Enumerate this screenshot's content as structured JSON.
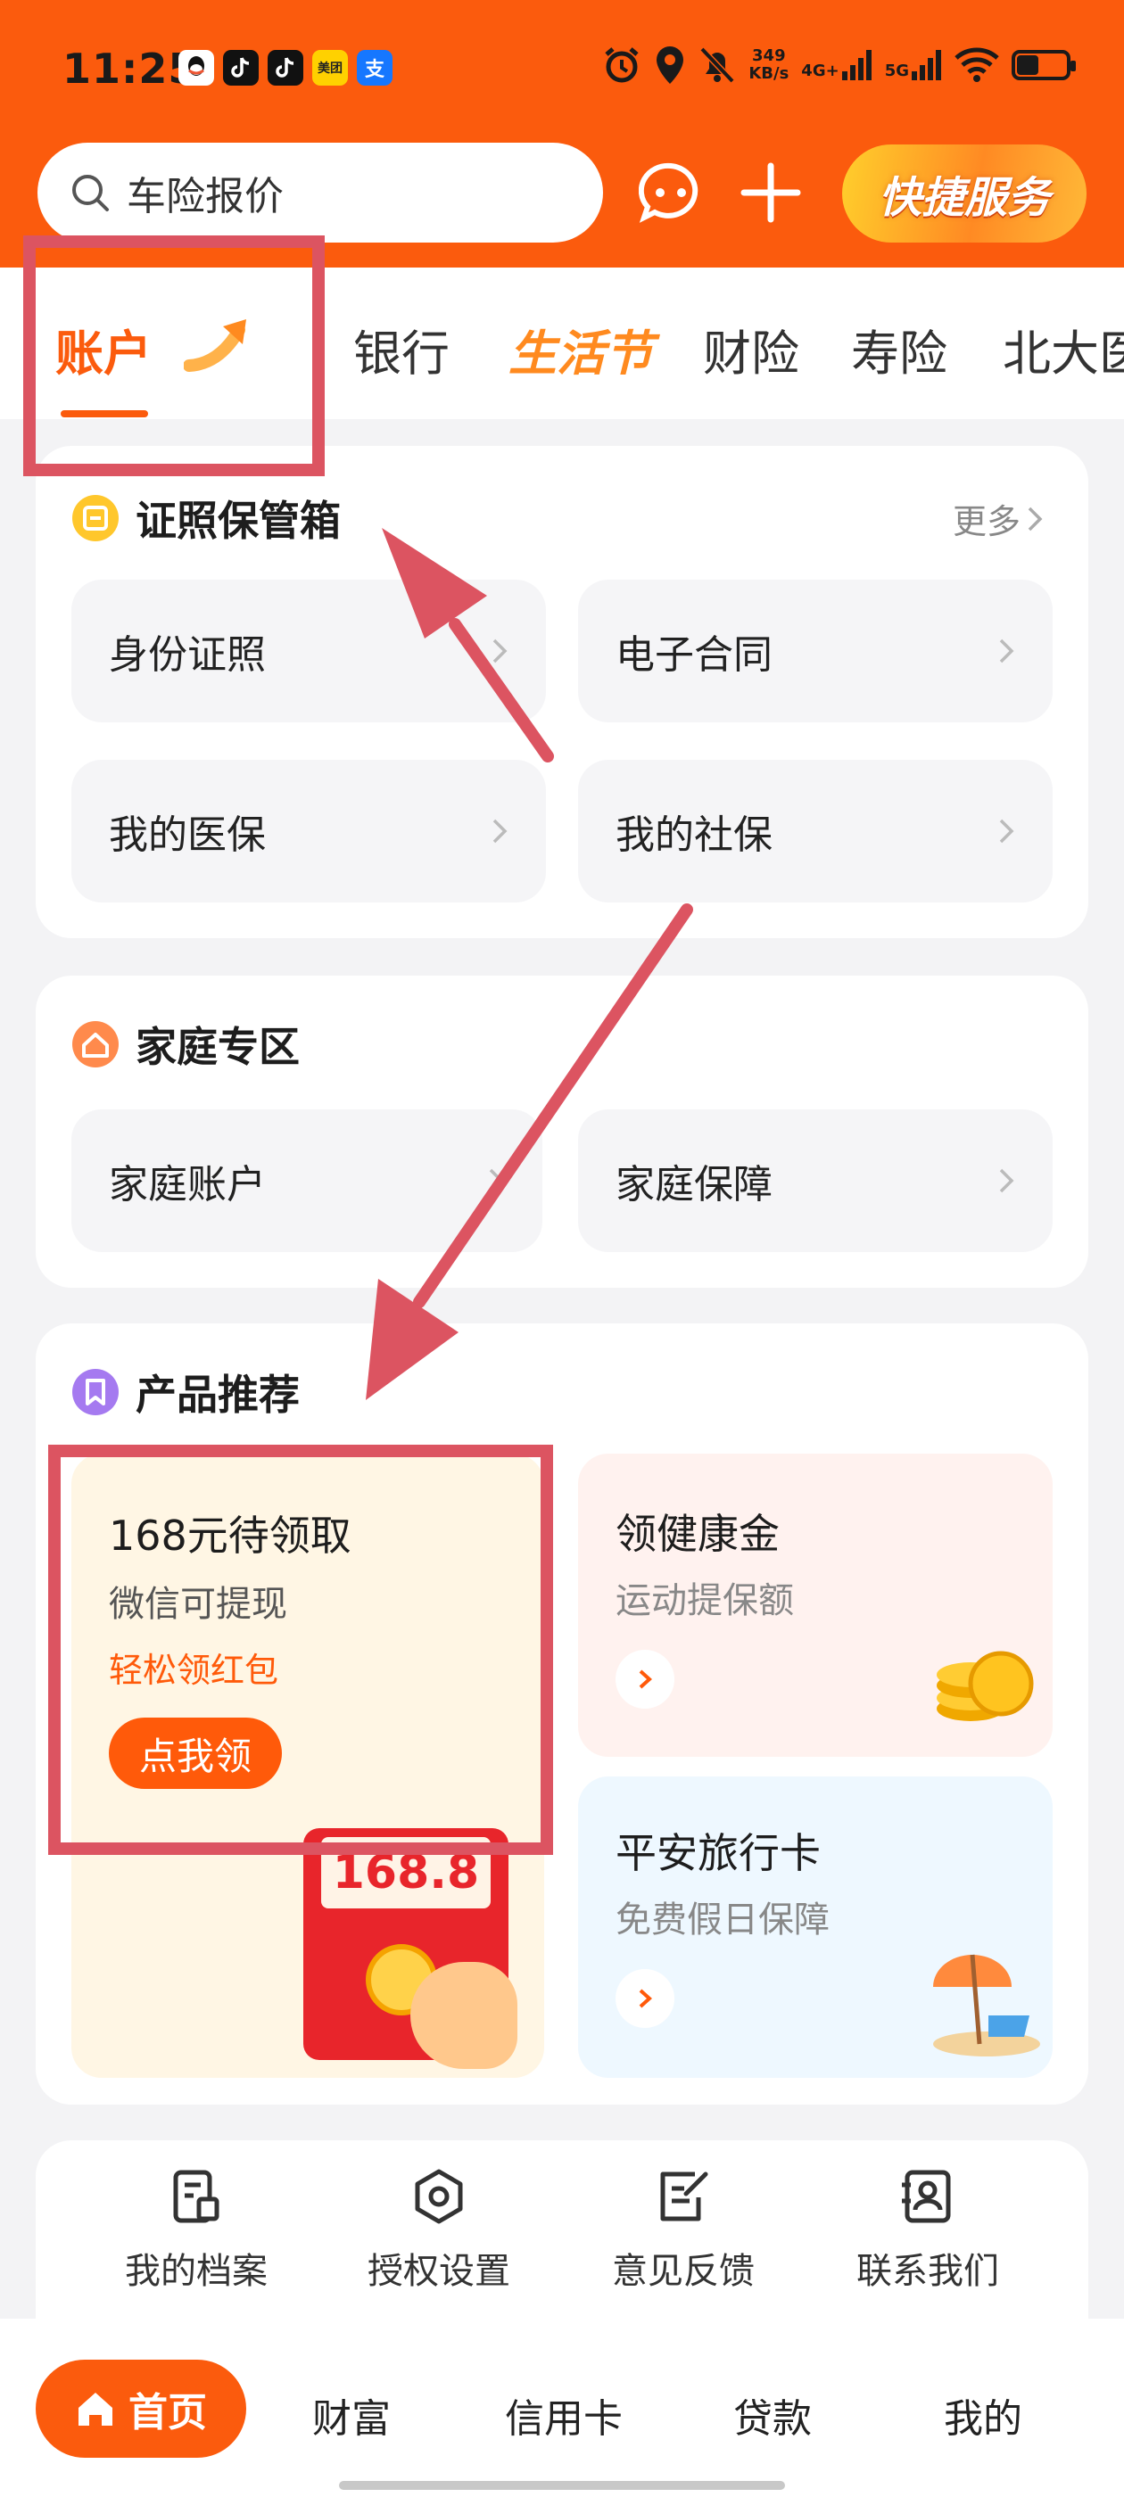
{
  "status_bar": {
    "time": "11:25",
    "net_speed_value": "349",
    "net_speed_unit": "KB/s",
    "signal_1": "4G+",
    "signal_2": "5G",
    "apps": [
      "qq",
      "tiktok",
      "tiktok",
      "meituan",
      "alipay"
    ],
    "meituan_label": "美团",
    "alipay_label": "支"
  },
  "header": {
    "search_placeholder": "车险报价",
    "quick_service_label": "快捷服务"
  },
  "tabs": [
    {
      "label": "账户",
      "active": true
    },
    {
      "label": "银行"
    },
    {
      "label": "生活节"
    },
    {
      "label": "财险"
    },
    {
      "label": "寿险"
    },
    {
      "label": "北大医"
    }
  ],
  "certificates": {
    "title": "证照保管箱",
    "more": "更多",
    "items": [
      "身份证照",
      "电子合同",
      "我的医保",
      "我的社保"
    ]
  },
  "family": {
    "title": "家庭专区",
    "items": [
      "家庭账户",
      "家庭保障"
    ]
  },
  "products": {
    "title": "产品推荐",
    "featured": {
      "title": "168元待领取",
      "subtitle": "微信可提现",
      "tag": "轻松领红包",
      "button": "点我领",
      "envelope_amount": "168.8"
    },
    "side": [
      {
        "title": "领健康金",
        "subtitle": "运动提保额"
      },
      {
        "title": "平安旅行卡",
        "subtitle": "免费假日保障"
      }
    ]
  },
  "tools": [
    "我的档案",
    "授权设置",
    "意见反馈",
    "联系我们"
  ],
  "bottom_nav": [
    "首页",
    "财富",
    "信用卡",
    "贷款",
    "我的"
  ],
  "colors": {
    "brand_orange": "#fb5b0d",
    "annotation_red": "#dc5461",
    "tile_bg": "#f5f5f7"
  }
}
